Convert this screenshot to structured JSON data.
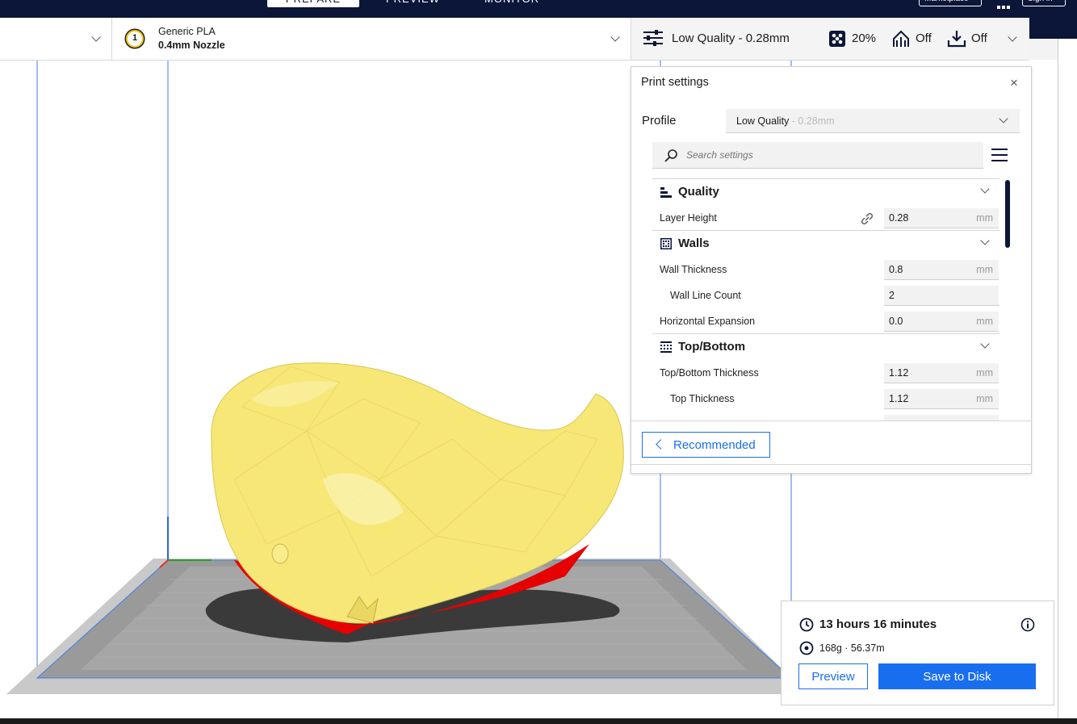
{
  "app": {
    "stage_tabs": [
      "PREPARE",
      "PREVIEW",
      "MONITOR"
    ],
    "marketplace_label": "Marketplace",
    "signin_label": "Sign in"
  },
  "toolbar": {
    "material_slot": "1",
    "material_name": "Generic PLA",
    "nozzle": "0.4mm Nozzle",
    "profile_summary": "Low Quality - 0.28mm",
    "infill": "20%",
    "support": "Off",
    "adhesion": "Off"
  },
  "print_settings": {
    "title": "Print settings",
    "profile_label": "Profile",
    "profile_name": "Low Quality",
    "profile_suffix": " - 0.28mm",
    "search_placeholder": "Search settings",
    "categories": [
      {
        "name": "Quality",
        "settings": [
          {
            "label": "Layer Height",
            "value": "0.28",
            "unit": "mm",
            "indent": false
          }
        ]
      },
      {
        "name": "Walls",
        "settings": [
          {
            "label": "Wall Thickness",
            "value": "0.8",
            "unit": "mm",
            "indent": false
          },
          {
            "label": "Wall Line Count",
            "value": "2",
            "unit": "",
            "indent": true
          },
          {
            "label": "Horizontal Expansion",
            "value": "0.0",
            "unit": "mm",
            "indent": false
          }
        ]
      },
      {
        "name": "Top/Bottom",
        "settings": [
          {
            "label": "Top/Bottom Thickness",
            "value": "1.12",
            "unit": "mm",
            "indent": false
          },
          {
            "label": "Top Thickness",
            "value": "1.12",
            "unit": "mm",
            "indent": true
          }
        ]
      }
    ],
    "recommended_label": "Recommended"
  },
  "summary": {
    "time": "13 hours 16 minutes",
    "material_usage": "168g · 56.37m",
    "preview_label": "Preview",
    "save_label": "Save to Disk"
  },
  "colors": {
    "accent": "#196ef0",
    "header": "#0b1638",
    "model": "#f6e777",
    "overhang": "#e60000"
  }
}
